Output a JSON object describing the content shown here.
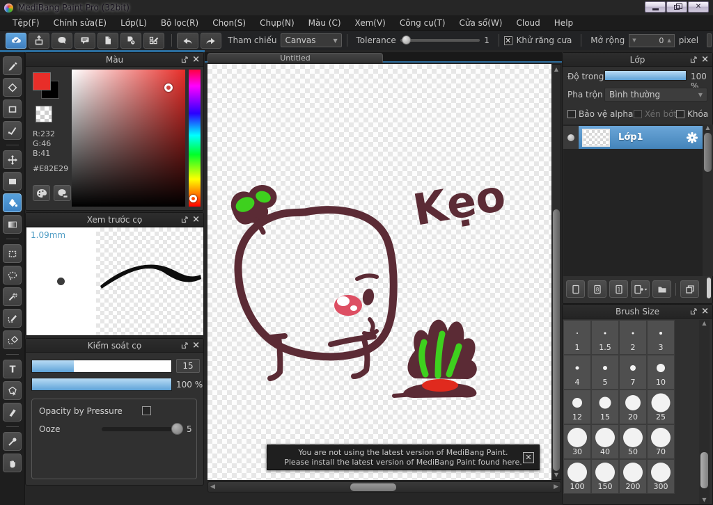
{
  "titlebar": {
    "title": "MediBang Paint Pro (32bit)"
  },
  "menubar": {
    "items": [
      "Tệp(F)",
      "Chỉnh sửa(E)",
      "Lớp(L)",
      "Bộ lọc(R)",
      "Chọn(S)",
      "Chụp(N)",
      "Màu (C)",
      "Xem(V)",
      "Công cụ(T)",
      "Cửa sổ(W)",
      "Cloud",
      "Help"
    ]
  },
  "toolbar": {
    "icons": [
      "cloud-save",
      "export",
      "chat",
      "comment",
      "document",
      "history",
      "material-edit"
    ],
    "ref_label": "Tham chiếu",
    "ref_value": "Canvas",
    "tolerance_label": "Tolerance",
    "tolerance_value": "1",
    "antialias_label": "Khử răng cưa",
    "expand_label": "Mở rộng",
    "expand_value": "0",
    "expand_unit": "pixel"
  },
  "tools": {
    "items": [
      "brush",
      "eraser",
      "rectangle",
      "polyline",
      "move",
      "fill-rect",
      "bucket",
      "gradient",
      "select-rectangle",
      "lasso",
      "magic-wand",
      "select-pen",
      "select-eraser",
      "text",
      "shape-select",
      "divide",
      "eyedropper",
      "hand"
    ],
    "active": "bucket"
  },
  "color_panel": {
    "title": "Màu",
    "r_label": "R:232",
    "g_label": "G:46",
    "b_label": "B:41",
    "hex_label": "#E82E29"
  },
  "brush_preview": {
    "title": "Xem trước cọ",
    "size_label": "1.09mm"
  },
  "brush_control": {
    "title": "Kiểm soát cọ",
    "size_value": "15",
    "opacity_value": "100 %",
    "pressure_label": "Opacity by Pressure",
    "ooze_label": "Ooze",
    "ooze_value": "5"
  },
  "canvas": {
    "tab": "Untitled",
    "drawing_text": "Kẹo"
  },
  "notification": {
    "line1": "You are not using the latest version of MediBang Paint.",
    "line2": "Please install the latest version of MediBang Paint found here."
  },
  "layers": {
    "title": "Lớp",
    "opacity_label": "Độ trong",
    "opacity_value": "100 %",
    "blend_label": "Pha trộn",
    "blend_value": "Bình thường",
    "alpha_protect_label": "Bảo vệ alpha",
    "clipping_label": "Xén bớt",
    "lock_label": "Khóa",
    "items": [
      {
        "name": "Lớp1"
      }
    ],
    "buttons": [
      {
        "name": "add-layer",
        "label": ""
      },
      {
        "name": "add-8bit-layer",
        "label": "8"
      },
      {
        "name": "add-1bit-layer",
        "label": "1"
      },
      {
        "name": "add-layer-menu",
        "label": ""
      },
      {
        "name": "layer-folder",
        "label": ""
      },
      {
        "name": "duplicate-layer",
        "label": ""
      }
    ]
  },
  "brush_size": {
    "title": "Brush Size",
    "sizes": [
      "1",
      "1.5",
      "2",
      "3",
      "4",
      "5",
      "7",
      "10",
      "12",
      "15",
      "20",
      "25",
      "30",
      "40",
      "50",
      "70",
      "100",
      "150",
      "200",
      "300"
    ]
  },
  "colors": {
    "accent_blue": "#4e9bd4",
    "swatch_red": "#E82E29",
    "drawing_maroon": "#5b2b35",
    "drawing_green": "#3ed01e",
    "drawing_red": "#e02a1e",
    "drawing_pink": "#dd4f63"
  }
}
